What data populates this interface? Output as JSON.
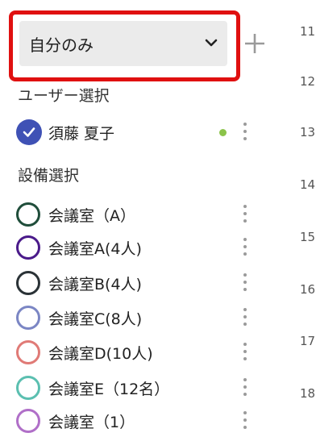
{
  "scope_select": {
    "value": "自分のみ"
  },
  "user_section": {
    "title": "ユーザー選択"
  },
  "users": [
    {
      "name": "須藤 夏子",
      "checked": true,
      "status_color": "#8bc34a"
    }
  ],
  "equipment_section": {
    "title": "設備選択"
  },
  "equipment": [
    {
      "label": "会議室（A）",
      "color": "#1f4d3a"
    },
    {
      "label": "会議室A(4人)",
      "color": "#4a1a8a"
    },
    {
      "label": "会議室B(4人)",
      "color": "#2a3236"
    },
    {
      "label": "会議室C(8人)",
      "color": "#7b86c4"
    },
    {
      "label": "会議室D(10人)",
      "color": "#e07a76"
    },
    {
      "label": "会議室E（12名）",
      "color": "#5bbfb0"
    },
    {
      "label": "会議室（1）",
      "color": "#b06fc8"
    }
  ],
  "hours": [
    "11",
    "12",
    "13",
    "14",
    "15",
    "16",
    "17",
    "18"
  ],
  "colors": {
    "highlight_border": "#e01010",
    "accent": "#3f51b5",
    "select_bg": "#ebebeb"
  }
}
